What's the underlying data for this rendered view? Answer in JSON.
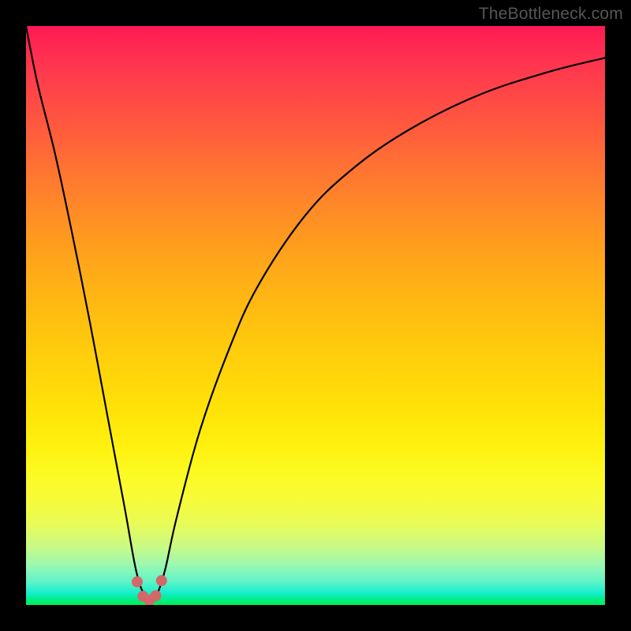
{
  "watermark": "TheBottleneck.com",
  "chart_data": {
    "type": "line",
    "title": "",
    "xlabel": "",
    "ylabel": "",
    "xlim": [
      0,
      100
    ],
    "ylim": [
      0,
      100
    ],
    "grid": false,
    "legend": false,
    "background_gradient": {
      "top_color": "#ff1a54",
      "mid_color": "#ffe208",
      "bottom_color": "#00ee58",
      "description": "vertical red→orange→yellow→green gradient (bottleneck severity scale)"
    },
    "series": [
      {
        "name": "bottleneck-curve",
        "color": "#000000",
        "x": [
          0,
          2,
          5,
          8,
          11,
          14,
          17,
          19,
          20.5,
          21.5,
          22.5,
          24,
          26,
          30,
          35,
          40,
          48,
          56,
          66,
          78,
          90,
          100
        ],
        "y": [
          100,
          90,
          78,
          64,
          49,
          33,
          17,
          6,
          1.5,
          0.5,
          1.5,
          6,
          15,
          30,
          44,
          55,
          67,
          75,
          82,
          88,
          92,
          94.5
        ]
      },
      {
        "name": "highlight-points",
        "type": "scatter",
        "color": "#d46767",
        "marker_size": 14,
        "x": [
          19.2,
          20.2,
          21.3,
          22.4,
          23.4
        ],
        "y": [
          4.0,
          1.5,
          0.8,
          1.6,
          4.2
        ]
      }
    ],
    "annotations": []
  },
  "colors": {
    "frame": "#000000",
    "curve": "#000000",
    "highlight": "#d46767",
    "watermark": "#565656"
  }
}
